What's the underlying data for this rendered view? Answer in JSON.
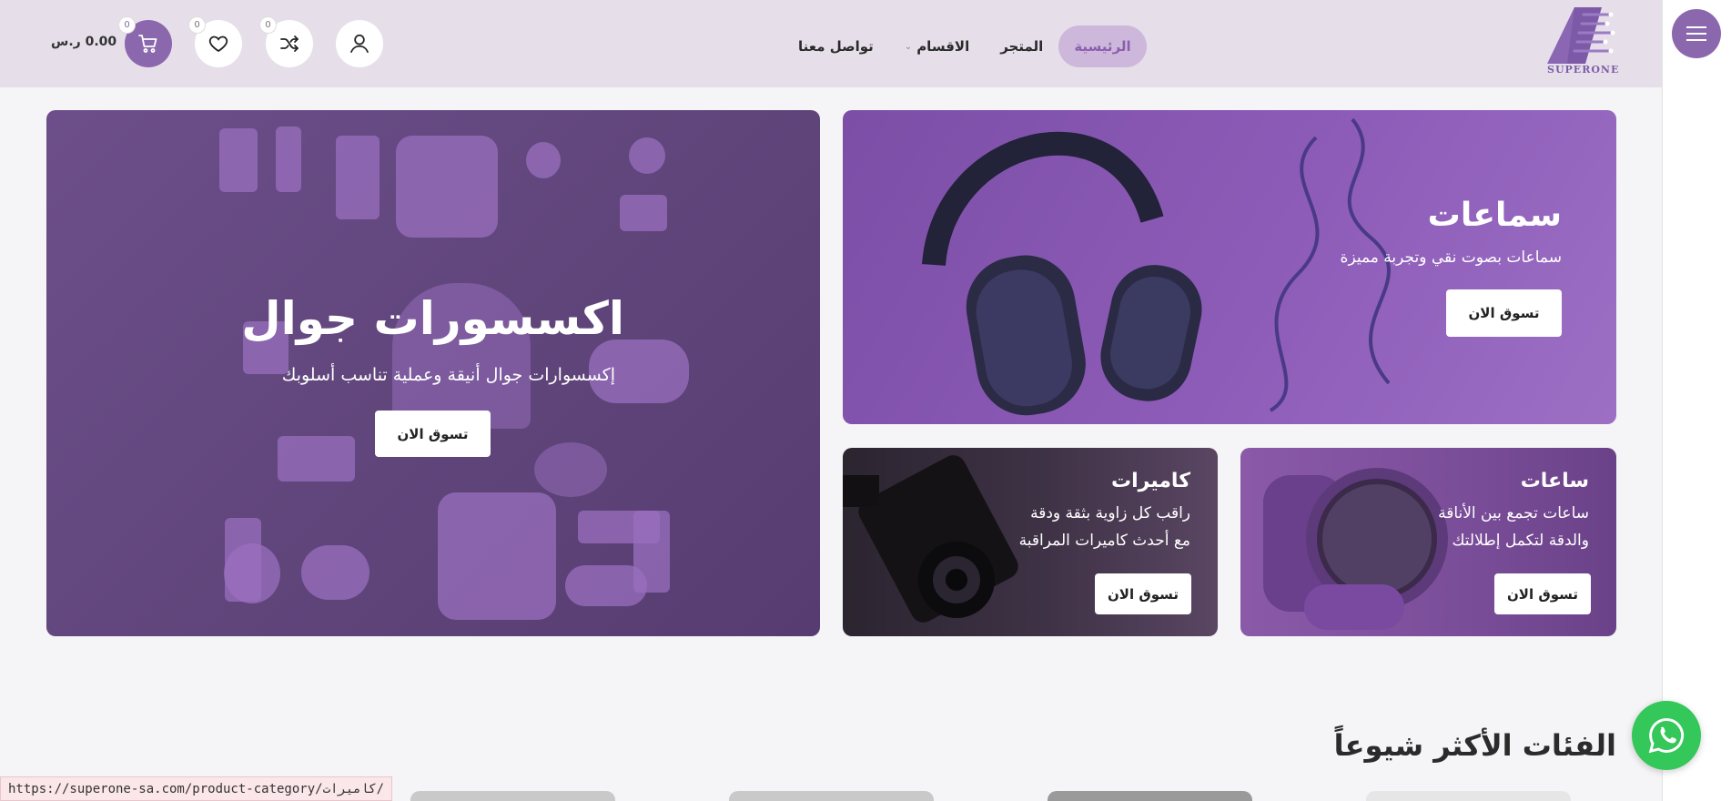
{
  "header": {
    "logo_text": "SUPERONE",
    "nav": [
      {
        "label": "الرئيسية"
      },
      {
        "label": "المتجر"
      },
      {
        "label": "الاقسام"
      },
      {
        "label": "تواصل معنا"
      }
    ],
    "cart_count": "0",
    "wishlist_count": "0",
    "compare_count": "0",
    "cart_total": "0.00 ر.س"
  },
  "banners": {
    "accessories": {
      "title": "اكسسورات جوال",
      "subtitle": "إكسسوارات جوال أنيقة وعملية تناسب أسلوبك",
      "button": "تسوق الان"
    },
    "headphones": {
      "title": "سماعات",
      "subtitle": "سماعات بصوت نقي وتجربة مميزة",
      "button": "تسوق الان"
    },
    "cameras": {
      "title": "كاميرات",
      "subtitle_line1": "راقب كل زاوية بثقة ودقة",
      "subtitle_line2": "مع أحدث كاميرات المراقبة",
      "button": "تسوق الان"
    },
    "watches": {
      "title": "ساعات",
      "subtitle_line1": "ساعات تجمع بين الأناقة",
      "subtitle_line2": "والدقة لتكمل إطلالتك",
      "button": "تسوق الان"
    }
  },
  "section": {
    "title": "الفئات الأكثر شيوعاً"
  },
  "status_bar": {
    "url": "https://superone-sa.com/product-category/كاميرات/"
  },
  "icons": [
    "menu-icon",
    "user-icon",
    "shuffle-icon",
    "heart-icon",
    "cart-icon",
    "whatsapp-icon",
    "chevron-down-icon"
  ],
  "colors": {
    "brand": "#8b68ad",
    "header_bg": "#e6dfea",
    "active_nav_bg": "#cdb8dc",
    "whatsapp": "#34c759"
  }
}
